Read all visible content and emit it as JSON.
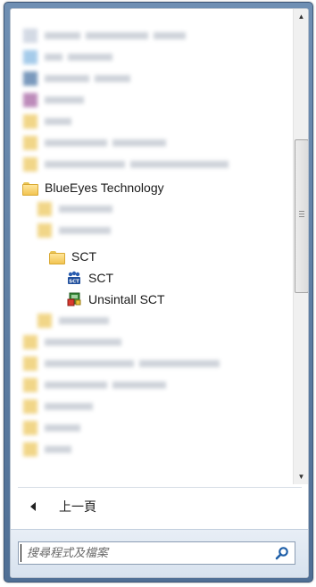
{
  "programs": {
    "folder_blueeyes": "BlueEyes Technology",
    "folder_sct": "SCT",
    "item_sct": "SCT",
    "item_uninstall": "Unsintall SCT"
  },
  "nav": {
    "back_label": "上一頁"
  },
  "search": {
    "placeholder": "搜尋程式及檔案"
  },
  "icons": {
    "folder": "folder-icon",
    "sct": "sct-app-icon",
    "uninstall": "uninstall-icon",
    "search": "search-icon",
    "back": "back-arrow-icon"
  }
}
